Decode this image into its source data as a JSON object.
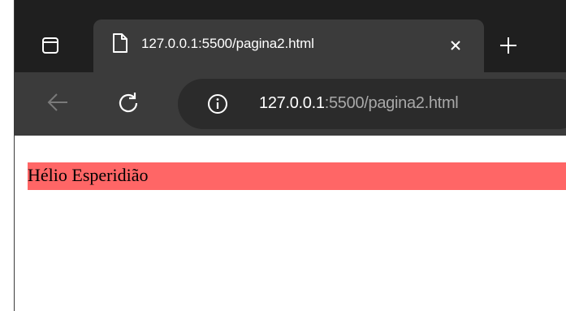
{
  "tab": {
    "title": "127.0.0.1:5500/pagina2.html",
    "icon": "page-icon",
    "close_icon": "close-icon"
  },
  "toolbar": {
    "back_icon": "back-arrow-icon",
    "reload_icon": "reload-icon",
    "info_icon": "info-icon"
  },
  "omnibox": {
    "host": "127.0.0.1",
    "rest": ":5500/pagina2.html"
  },
  "page": {
    "text": "Hélio Esperidião",
    "highlight_color": "#ff6666"
  },
  "colors": {
    "tabstrip": "#1f1f1f",
    "toolbar": "#3b3b3b",
    "omnibox": "#2b2b2b"
  }
}
